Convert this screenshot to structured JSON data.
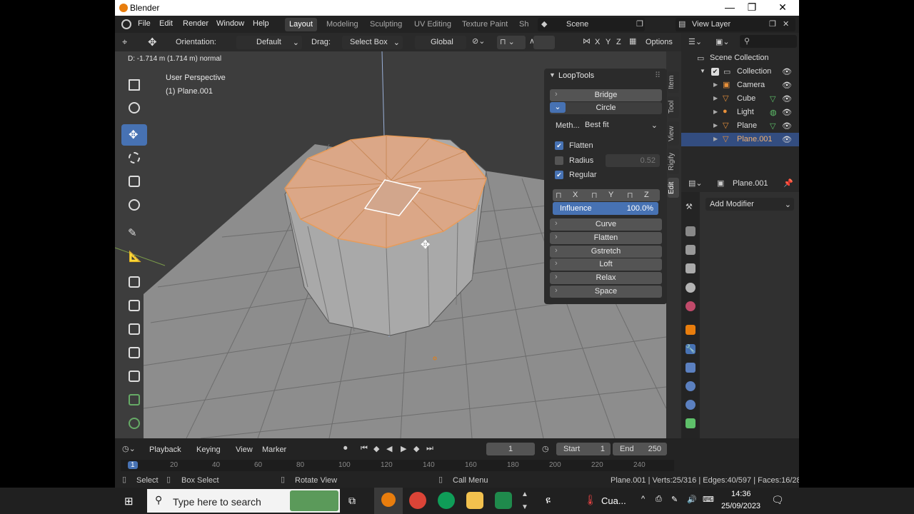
{
  "window": {
    "title": "Blender",
    "minimize": "—",
    "maximize": "❐",
    "close": "✕"
  },
  "menu": [
    "File",
    "Edit",
    "Render",
    "Window",
    "Help"
  ],
  "workspaces": [
    "Layout",
    "Modeling",
    "Sculpting",
    "UV Editing",
    "Texture Paint",
    "Sh"
  ],
  "scene": "Scene",
  "view_layer": "View Layer",
  "header": {
    "orientation_label": "Orientation:",
    "orientation_value": "Default",
    "drag_label": "Drag:",
    "drag_value": "Select Box",
    "transform_value": "Global",
    "axes": [
      "X",
      "Y",
      "Z"
    ],
    "options": "Options"
  },
  "viewport": {
    "status_text": "D: -1.714 m (1.714 m) normal",
    "perspective": "User Perspective",
    "object": "(1) Plane.001"
  },
  "looptools": {
    "title": "LoopTools",
    "bridge": "Bridge",
    "circle": "Circle",
    "method_label": "Meth...",
    "method_value": "Best fit",
    "flatten_check": "Flatten",
    "radius_check": "Radius",
    "radius_value": "0.52",
    "regular_check": "Regular",
    "axes": [
      "X",
      "Y",
      "Z"
    ],
    "influence_label": "Influence",
    "influence_value": "100.0%",
    "influence_fraction": 1.0,
    "tools": [
      "Curve",
      "Flatten",
      "Gstretch",
      "Loft",
      "Relax",
      "Space"
    ]
  },
  "sidebar_tabs": [
    "Item",
    "Tool",
    "View",
    "Rigify",
    "Edit"
  ],
  "outliner": {
    "root": "Scene Collection",
    "collection": "Collection",
    "items": [
      "Camera",
      "Cube",
      "Light",
      "Plane",
      "Plane.001"
    ]
  },
  "properties": {
    "object_name": "Plane.001",
    "add_modifier": "Add Modifier"
  },
  "timeline": {
    "playback": "Playback",
    "keying": "Keying",
    "view": "View",
    "marker": "Marker",
    "current_frame": "1",
    "start_label": "Start",
    "start_value": "1",
    "end_label": "End",
    "end_value": "250",
    "ruler": [
      "1",
      "20",
      "40",
      "60",
      "80",
      "100",
      "120",
      "140",
      "160",
      "180",
      "200",
      "220",
      "240"
    ]
  },
  "statusbar": {
    "select": "Select",
    "box_select": "Box Select",
    "rotate_view": "Rotate View",
    "call_menu": "Call Menu",
    "stats": "Plane.001 | Verts:25/316 | Edges:40/597 | Faces:16/28"
  },
  "taskbar": {
    "search": "Type here to search",
    "weather": "Cua...",
    "time": "14:36",
    "date": "25/09/2023"
  },
  "colors": {
    "accent": "#4772b3",
    "selection": "#e89c5a",
    "blender_orange": "#e87d0d"
  }
}
